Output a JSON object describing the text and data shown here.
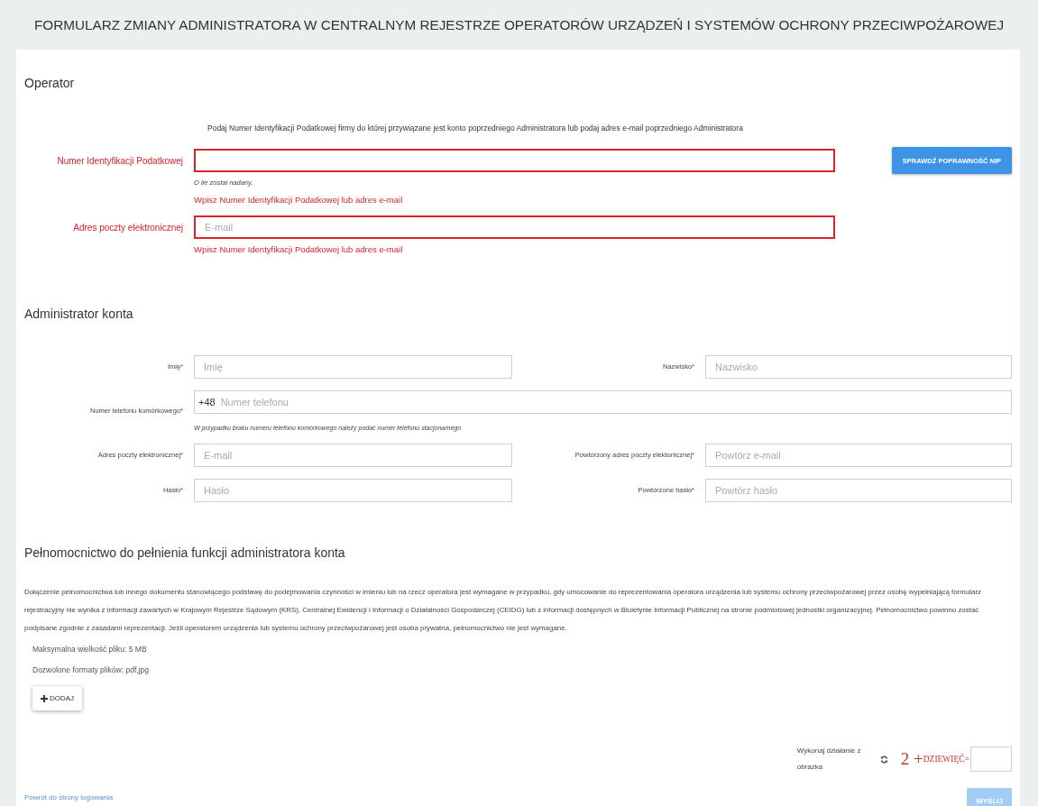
{
  "title": "FORMULARZ ZMIANY ADMINISTRATORA W CENTRALNYM REJESTRZE OPERATORÓW URZĄDZEŃ I SYSTEMÓW OCHRONY PRZECIWPOŻAROWEJ",
  "operator": {
    "heading": "Operator",
    "intro": "Podaj Numer Identyfikacji Podatkowej firmy do której przywiązane jest konto poprzedniego Administratora lub podaj adres e-mail poprzedniego Administratora",
    "fields": [
      {
        "label": "Numer Identyfikacji Podatkowej",
        "invalid": true,
        "hint": "O ile został nadany.",
        "error": "Wpisz Numer Identyfikacji Podatkowej lub adres e-mail",
        "button": "SPRAWDŹ POPRAWNOŚĆ NIP"
      },
      {
        "label": "Adres poczty elektronicznej",
        "invalid": true,
        "placeholder": "E-mail",
        "error": "Wpisz Numer Identyfikacji Podatkowej lub adres e-mail"
      }
    ]
  },
  "admin": {
    "heading": "Administrator konta",
    "fields": [
      {
        "kind": "half",
        "label": "Imię",
        "mark": "*",
        "placeholder": "Imię"
      },
      {
        "kind": "half",
        "label": "Nazwisko",
        "mark": "*",
        "placeholder": "Nazwisko"
      },
      {
        "kind": "full",
        "label": "Numer telefonu komórkowego",
        "mark": "*",
        "prefix": "+48",
        "placeholder": "Numer telefonu",
        "hint": "W przypadku braku numeru telefonu komórkowego należy podać numer telefonu stacjonarnego"
      },
      {
        "kind": "half",
        "label": "Adres poczty elektronicznej",
        "mark": "*",
        "placeholder": "E-mail"
      },
      {
        "kind": "half",
        "label": "Powtórzony adres poczty elektonicznej",
        "mark": "*",
        "placeholder": "Powtórz e-mail"
      },
      {
        "kind": "half",
        "label": "Hasło",
        "mark": "*",
        "placeholder": "Hasło"
      },
      {
        "kind": "half",
        "label": "Powtórzone hasło",
        "mark": "*",
        "placeholder": "Powtórz hasło"
      }
    ]
  },
  "authorization": {
    "heading": "Pełnomocnictwo do pełnienia funkcji administratora konta",
    "paragraph": "Dołączenie pełnomocnictwa lub innego dokumentu stanowiącego podstawę do podejmowania czynności w imieniu lub na rzecz operatora jest wymagane w przypadku, gdy umocowanie do reprezentowania operatora urządzenia lub systemu ochrony przeciwpożarowej przez osobę wypełniającą formularz rejestracyjny nie wynika z informacji zawartych w Krajowym Rejestrze Sądowym (KRS), Centralnej Ewidencji i Informacji o Działalności Gospodarczej (CEIDG) lub z informacji dostępnych w Biuletynie Informacji Publicznej na stronie podmiotowej jednostki organizacyjnej. Pełnomocnictwo powinno zostać podpisane zgodnie z zasadami reprezentacji. Jeśli operatorem urządzenia lub systemu ochrony przeciwpożarowej jest osoba prywatna, pełnomocnictwo nie jest wymagane.",
    "max_size": "Maksymalna wielkość pliku: 5 MB",
    "formats": "Dozwolone formaty plików: pdf,jpg",
    "add_button": "DODAJ"
  },
  "captcha": {
    "label": "Wykonaj działanie z obrazka",
    "number": "2 +",
    "word": "DZIEWIĘĆ="
  },
  "back_link": "Powrót do strony logowania",
  "submit_button": {
    "label": "WYŚLIJ",
    "disabled": true
  }
}
